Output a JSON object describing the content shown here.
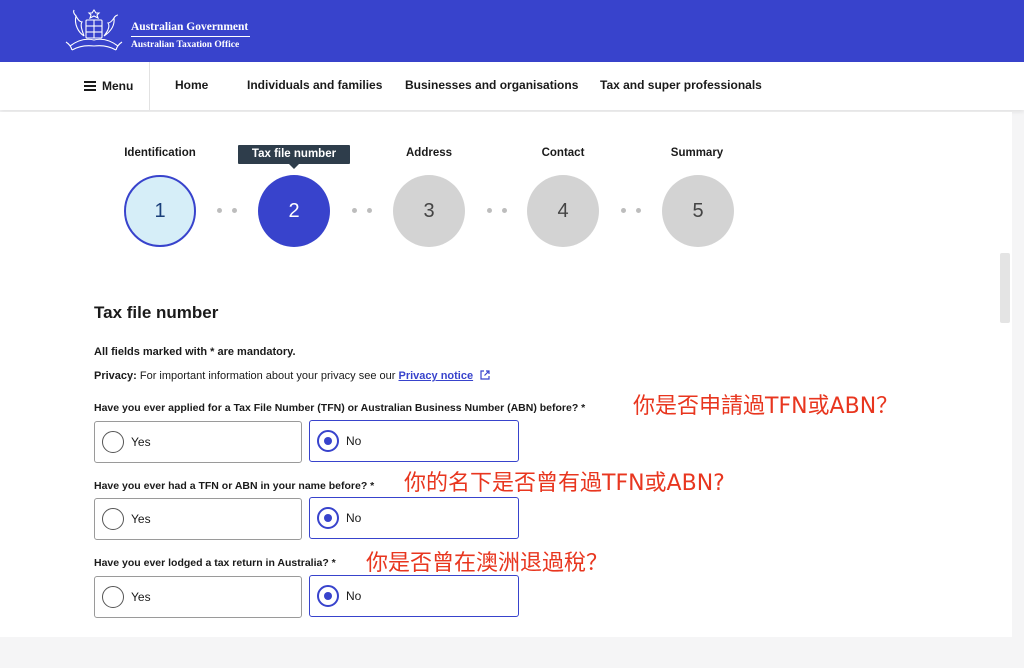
{
  "header": {
    "gov_line1": "Australian Government",
    "gov_line2": "Australian Taxation Office",
    "brand_color": "#3843cc"
  },
  "nav": {
    "menu_label": "Menu",
    "links": [
      "Home",
      "Individuals and families",
      "Businesses and organisations",
      "Tax and super professionals"
    ]
  },
  "steps": [
    {
      "label": "Identification",
      "number": "1",
      "state": "done"
    },
    {
      "label": "Tax file number",
      "number": "2",
      "state": "current"
    },
    {
      "label": "Address",
      "number": "3",
      "state": "todo"
    },
    {
      "label": "Contact",
      "number": "4",
      "state": "todo"
    },
    {
      "label": "Summary",
      "number": "5",
      "state": "todo"
    }
  ],
  "form": {
    "title": "Tax file number",
    "mandatory_note": "All fields marked with * are mandatory.",
    "privacy_label": "Privacy:",
    "privacy_text": " For important information about your privacy see our ",
    "privacy_link": "Privacy notice",
    "questions": [
      {
        "text": "Have you ever applied for a Tax File Number (TFN) or Australian Business Number (ABN) before? *",
        "annotation": "你是否申請過TFN或ABN？",
        "options": [
          "Yes",
          "No"
        ],
        "selected": "No"
      },
      {
        "text": "Have you ever had a TFN or ABN in your name before? *",
        "annotation": "你的名下是否曾有過TFN或ABN?",
        "options": [
          "Yes",
          "No"
        ],
        "selected": "No"
      },
      {
        "text": "Have you ever lodged a tax return in Australia? *",
        "annotation": "你是否曾在澳洲退過稅？",
        "options": [
          "Yes",
          "No"
        ],
        "selected": "No"
      }
    ]
  }
}
